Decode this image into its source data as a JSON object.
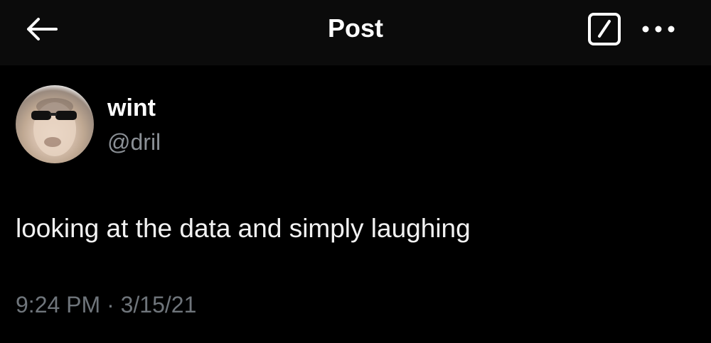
{
  "header": {
    "title": "Post",
    "back_icon": "arrow-left-icon",
    "grok_icon": "grok-icon",
    "more_icon": "more-horizontal-icon"
  },
  "post": {
    "author": {
      "display_name": "wint",
      "handle": "@dril",
      "avatar_icon": "avatar-photo"
    },
    "text": "looking at the data and simply laughing",
    "time": "9:24 PM",
    "separator": "·",
    "date": "3/15/21"
  },
  "colors": {
    "background": "#000000",
    "header_background": "#0b0b0b",
    "primary_text": "#ffffff",
    "secondary_text": "#8b9096",
    "timestamp_text": "#6f757b"
  }
}
